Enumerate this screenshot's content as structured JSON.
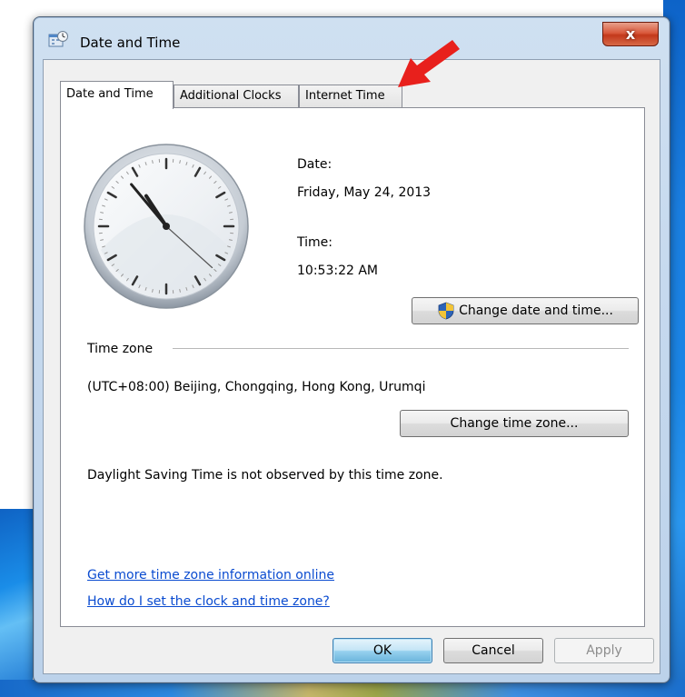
{
  "window": {
    "title": "Date and Time",
    "close_label": "x"
  },
  "tabs": [
    {
      "label": "Date and Time",
      "active": true
    },
    {
      "label": "Additional Clocks",
      "active": false
    },
    {
      "label": "Internet Time",
      "active": false
    }
  ],
  "clock": {
    "time_shown": "10:53:22"
  },
  "datetime": {
    "date_label": "Date:",
    "date_value": "Friday, May 24, 2013",
    "time_label": "Time:",
    "time_value": "10:53:22 AM",
    "change_button": "Change date and time..."
  },
  "timezone": {
    "group_label": "Time zone",
    "value": "(UTC+08:00) Beijing, Chongqing, Hong Kong, Urumqi",
    "change_button": "Change time zone...",
    "dst_note": "Daylight Saving Time is not observed by this time zone."
  },
  "links": {
    "more_info": "Get more time zone information online",
    "how_to": "How do I set the clock and time zone?"
  },
  "footer": {
    "ok": "OK",
    "cancel": "Cancel",
    "apply": "Apply"
  },
  "colors": {
    "annotation_arrow": "#e8201c",
    "link": "#0a4bd0"
  }
}
